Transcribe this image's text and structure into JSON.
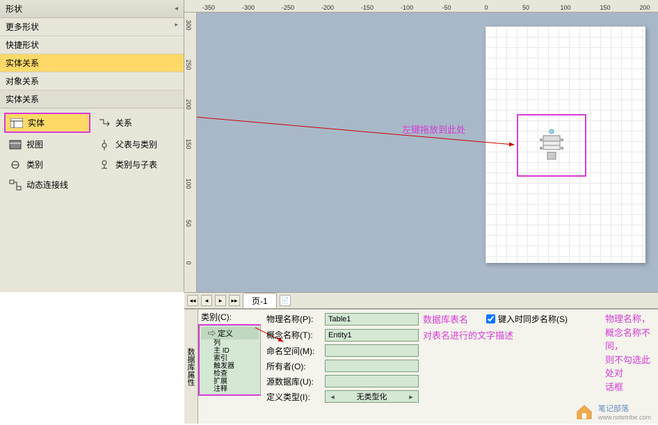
{
  "sidebar": {
    "header": "形状",
    "items": [
      {
        "label": "更多形状"
      },
      {
        "label": "快捷形状"
      },
      {
        "label": "实体关系",
        "selected": true
      },
      {
        "label": "对象关系"
      }
    ],
    "subheader": "实体关系",
    "shapes": [
      {
        "label": "实体",
        "name": "shape-entity",
        "highlighted": true
      },
      {
        "label": "关系",
        "name": "shape-relation"
      },
      {
        "label": "视图",
        "name": "shape-view"
      },
      {
        "label": "父表与类别",
        "name": "shape-parent-category"
      },
      {
        "label": "类别",
        "name": "shape-category"
      },
      {
        "label": "类别与子表",
        "name": "shape-category-child"
      },
      {
        "label": "动态连接线",
        "name": "shape-dynamic-connector",
        "span": true
      }
    ]
  },
  "ruler_h": [
    "-350",
    "-300",
    "-250",
    "-200",
    "-150",
    "-100",
    "-50",
    "0",
    "50",
    "100",
    "150",
    "200"
  ],
  "ruler_v": [
    "300",
    "250",
    "200",
    "150",
    "100",
    "50",
    "0"
  ],
  "annotations": {
    "drag_hint": "左键拖放到此处",
    "db_table_name": "数据库表名",
    "table_desc": "对表名进行的文字描述",
    "sync_note_l1": "物理名称，",
    "sync_note_l2": "概念名称不同，",
    "sync_note_l3": "则不勾选此处对",
    "sync_note_l4": "话框"
  },
  "tabs": {
    "page1": "页-1"
  },
  "props": {
    "vtab": "数据库属性",
    "tree_header": "类别(C):",
    "tree": {
      "def": "定义",
      "sub": [
        "列",
        "主 ID",
        "索引",
        "触发器",
        "检查",
        "扩展",
        "注释"
      ]
    },
    "form": {
      "phys_name_label": "物理名称(P):",
      "phys_name_value": "Table1",
      "concept_name_label": "概念名称(T):",
      "concept_name_value": "Entity1",
      "namespace_label": "命名空间(M):",
      "namespace_value": "",
      "owner_label": "所有者(O):",
      "owner_value": "",
      "source_db_label": "源数据库(U):",
      "source_db_value": "",
      "def_type_label": "定义类型(I):",
      "def_type_value": "无类型化",
      "sync_checkbox": "键入时同步名称(S)"
    }
  },
  "watermark": {
    "title": "笔记部落",
    "sub": "www.notetribe.com"
  }
}
